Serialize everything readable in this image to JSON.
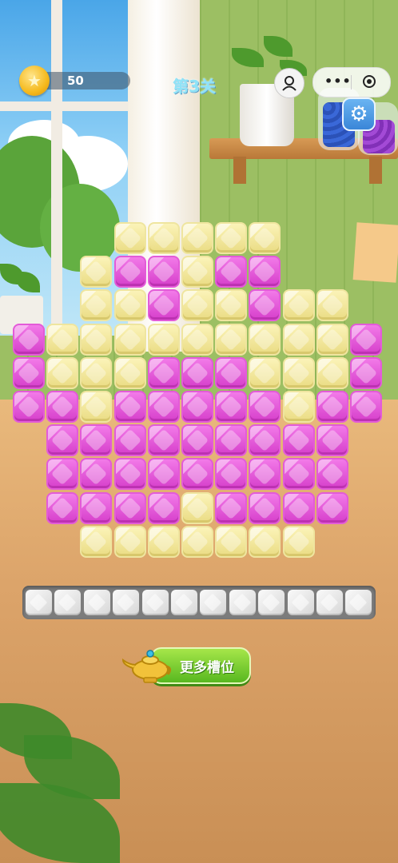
{
  "hud": {
    "coins": "50",
    "level": "第3关"
  },
  "colors": {
    "yellow": "#f4e9a0",
    "pink": "#e24fd6"
  },
  "board": {
    "cols": 11,
    "rows": 10,
    "grid": [
      "...YYYYY...",
      "..YPPYPP...",
      "..YYPYYPYY.",
      "PYYYYYYYYYP",
      "PYYYPPPYYYP",
      "PPYPPPPPYPP",
      ".PPPPPPPPP.",
      ".PPPPPPPPP.",
      ".PPPPYPPPP.",
      "..YYYYYYY.."
    ]
  },
  "slots": {
    "count": 12,
    "filled": 0
  },
  "more_slots_button": {
    "label": "更多槽位"
  },
  "icons": [
    "coin-icon",
    "avatar-icon",
    "more-dots-icon",
    "target-icon",
    "gear-icon",
    "magic-lamp-icon"
  ]
}
